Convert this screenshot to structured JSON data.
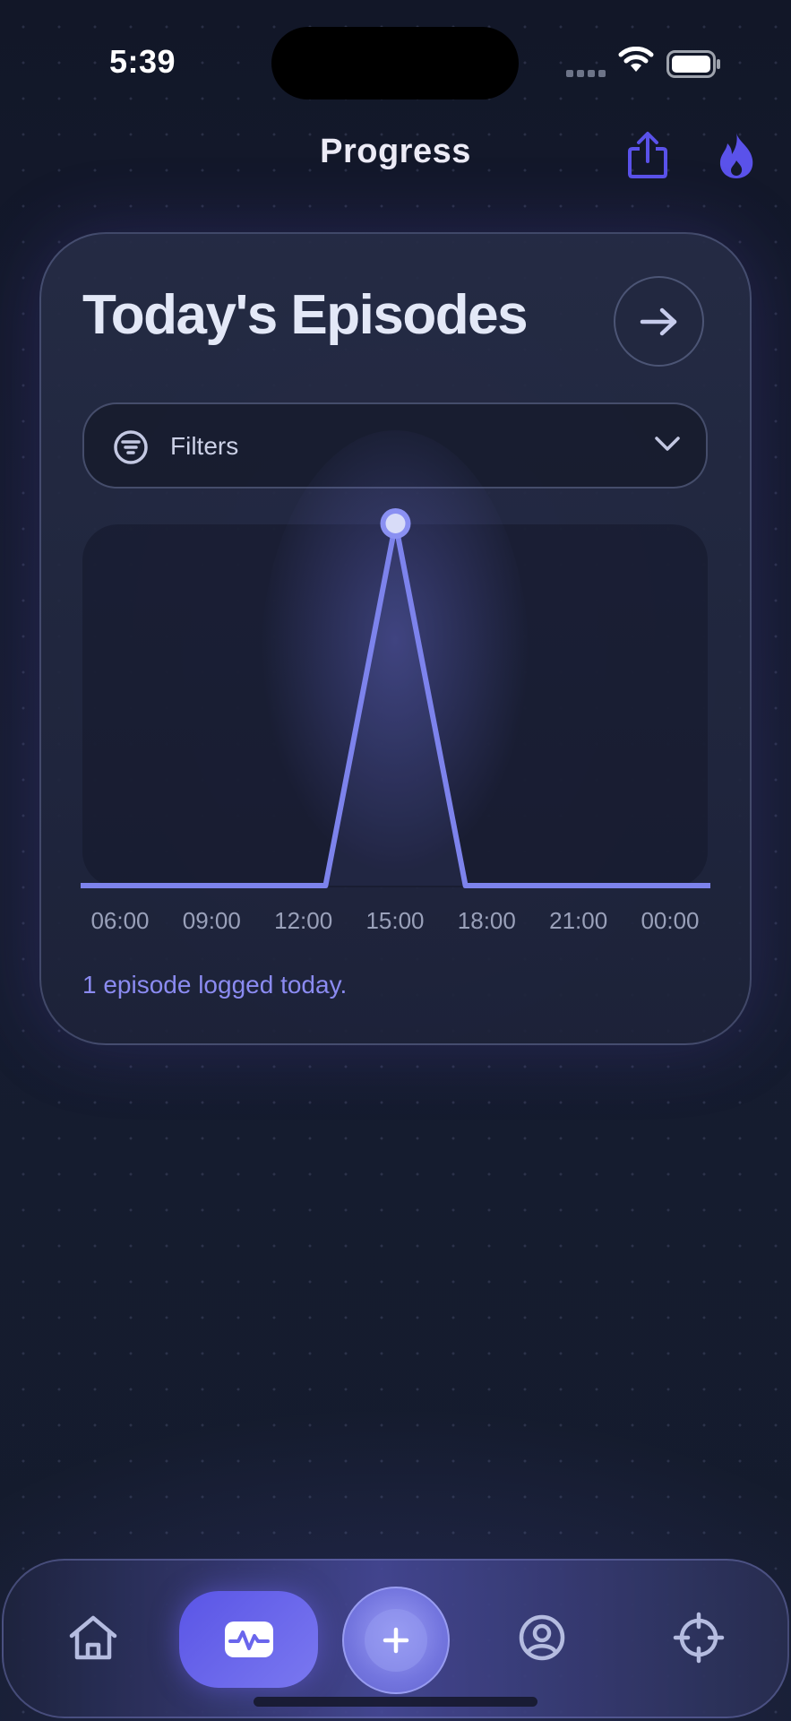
{
  "status_bar": {
    "time": "5:39"
  },
  "header": {
    "title": "Progress",
    "share_icon": "share-icon",
    "streak_icon": "fire-icon"
  },
  "card": {
    "title": "Today's Episodes",
    "filters_label": "Filters",
    "summary": "1 episode logged today."
  },
  "colors": {
    "accent": "#7b80f0",
    "brand_fire": "#5a52ea",
    "line": "#7d83ec"
  },
  "chart_data": {
    "type": "line",
    "x": [
      "06:00",
      "09:00",
      "12:00",
      "13:00",
      "15:00",
      "17:00",
      "18:00",
      "21:00",
      "00:00"
    ],
    "series": [
      {
        "values": [
          0,
          0,
          0,
          0,
          1,
          0,
          0,
          0,
          0
        ]
      }
    ],
    "tick_labels": [
      "06:00",
      "09:00",
      "12:00",
      "15:00",
      "18:00",
      "21:00",
      "00:00"
    ],
    "ylim": [
      0,
      1
    ],
    "grid": false,
    "highlight_point": {
      "x": "15:00",
      "y": 1
    }
  },
  "tabbar": {
    "items": [
      {
        "name": "home",
        "icon": "home-icon"
      },
      {
        "name": "activity",
        "icon": "activity-icon",
        "selected": true
      },
      {
        "name": "add",
        "icon": "plus-icon"
      },
      {
        "name": "profile",
        "icon": "user-circle-icon"
      },
      {
        "name": "goals",
        "icon": "crosshair-icon"
      }
    ]
  }
}
